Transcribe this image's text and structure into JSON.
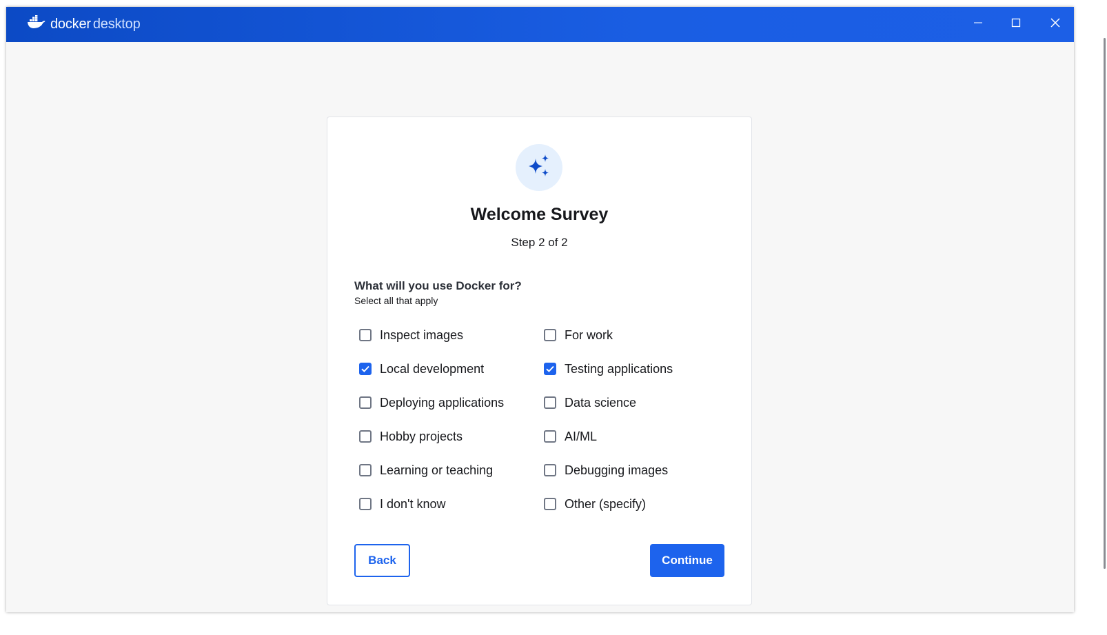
{
  "titlebar": {
    "brand_word1": "docker",
    "brand_word2": "desktop",
    "icons": {
      "logo": "docker-whale-icon",
      "minimize": "minimize-icon",
      "maximize": "maximize-icon",
      "close": "close-icon"
    }
  },
  "survey": {
    "icon": "sparkles-icon",
    "title": "Welcome Survey",
    "step": "Step 2 of 2",
    "question": "What will you use Docker for?",
    "hint": "Select all that apply",
    "options": [
      {
        "label": "Inspect images",
        "checked": false
      },
      {
        "label": "For work",
        "checked": false
      },
      {
        "label": "Local development",
        "checked": true
      },
      {
        "label": "Testing applications",
        "checked": true
      },
      {
        "label": "Deploying applications",
        "checked": false
      },
      {
        "label": "Data science",
        "checked": false
      },
      {
        "label": "Hobby projects",
        "checked": false
      },
      {
        "label": "AI/ML",
        "checked": false
      },
      {
        "label": "Learning or teaching",
        "checked": false
      },
      {
        "label": "Debugging images",
        "checked": false
      },
      {
        "label": "I don't know",
        "checked": false
      },
      {
        "label": "Other (specify)",
        "checked": false
      }
    ],
    "back_label": "Back",
    "continue_label": "Continue"
  },
  "colors": {
    "titlebar_start": "#0c4ac5",
    "titlebar_end": "#1c5fe6",
    "accent": "#1d63ed",
    "hero_bg": "#e5f0fd",
    "background": "#f7f7f7"
  }
}
